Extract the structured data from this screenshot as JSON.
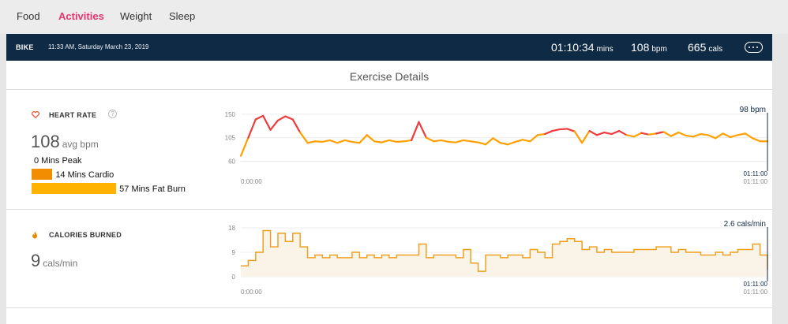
{
  "nav": {
    "tabs": [
      {
        "label": "Food",
        "active": false
      },
      {
        "label": "Activities",
        "active": true
      },
      {
        "label": "Weight",
        "active": false
      },
      {
        "label": "Sleep",
        "active": false
      }
    ]
  },
  "header": {
    "activity_type": "BIKE",
    "timestamp": "11:33 AM, Saturday March 23, 2019",
    "duration": "01:10:34",
    "duration_unit": "mins",
    "heart_rate": "108",
    "heart_rate_unit": "bpm",
    "calories": "665",
    "calories_unit": "cals",
    "menu_icon": "more-dots-icon"
  },
  "section_title": "Exercise Details",
  "heart_rate": {
    "label": "HEART RATE",
    "help_label": "?",
    "avg_value": "108",
    "avg_unit": "avg bpm",
    "zones": [
      {
        "label": "0 Mins Peak",
        "minutes": 0
      },
      {
        "label": "14 Mins Cardio",
        "minutes": 14,
        "color": "#f28c00"
      },
      {
        "label": "57 Mins Fat Burn",
        "minutes": 57,
        "color": "#ffb300"
      }
    ],
    "icon": "heart-icon",
    "accent": "#e8553a"
  },
  "calories": {
    "label": "CALORIES BURNED",
    "value": "9",
    "unit": "cals/min",
    "icon": "flame-icon",
    "accent": "#e88a00"
  },
  "chart_data": [
    {
      "type": "line",
      "title": "",
      "ylim": [
        50,
        165
      ],
      "yticks": [
        "150",
        "105",
        "60"
      ],
      "ytick_values": [
        150,
        105,
        60
      ],
      "x_start_label": "0:00:00",
      "x_end_label": "01:11:00",
      "cursor_readout": "98 bpm",
      "cursor_time": "01:11:00",
      "colors": {
        "low": "#8cc43c",
        "mid": "#ffa000",
        "high": "#ee3b3b"
      },
      "x": [
        0,
        1,
        2,
        3,
        4,
        5,
        6,
        7,
        8,
        9,
        10,
        11,
        12,
        13,
        14,
        15,
        16,
        17,
        18,
        19,
        20,
        21,
        22,
        23,
        24,
        25,
        26,
        27,
        28,
        29,
        30,
        31,
        32,
        33,
        34,
        35,
        36,
        37,
        38,
        39,
        40,
        41,
        42,
        43,
        44,
        45,
        46,
        47,
        48,
        49,
        50,
        51,
        52,
        53,
        54,
        55,
        56,
        57,
        58,
        59,
        60,
        61,
        62,
        63,
        64,
        65,
        66,
        67,
        68,
        69,
        70,
        71
      ],
      "values": [
        70,
        105,
        140,
        147,
        120,
        138,
        146,
        140,
        115,
        95,
        98,
        97,
        100,
        95,
        100,
        97,
        95,
        110,
        98,
        96,
        100,
        97,
        98,
        100,
        135,
        105,
        98,
        100,
        97,
        96,
        100,
        98,
        96,
        92,
        104,
        95,
        92,
        97,
        101,
        98,
        110,
        112,
        118,
        121,
        122,
        117,
        95,
        118,
        110,
        115,
        112,
        118,
        110,
        107,
        114,
        111,
        113,
        116,
        108,
        115,
        109,
        107,
        112,
        110,
        104,
        113,
        106,
        110,
        113,
        104,
        98,
        98
      ]
    },
    {
      "type": "area",
      "title": "",
      "ylim": [
        0,
        18
      ],
      "yticks": [
        "18",
        "9",
        "0"
      ],
      "ytick_values": [
        18,
        9,
        0
      ],
      "x_start_label": "0:00:00",
      "x_end_label": "01:11:00",
      "cursor_readout": "2.6 cals/min",
      "cursor_time": "01:11:00",
      "colors": {
        "line": "#f0a020",
        "fill": "#faf3e7"
      },
      "x": [
        0,
        1,
        2,
        3,
        4,
        5,
        6,
        7,
        8,
        9,
        10,
        11,
        12,
        13,
        14,
        15,
        16,
        17,
        18,
        19,
        20,
        21,
        22,
        23,
        24,
        25,
        26,
        27,
        28,
        29,
        30,
        31,
        32,
        33,
        34,
        35,
        36,
        37,
        38,
        39,
        40,
        41,
        42,
        43,
        44,
        45,
        46,
        47,
        48,
        49,
        50,
        51,
        52,
        53,
        54,
        55,
        56,
        57,
        58,
        59,
        60,
        61,
        62,
        63,
        64,
        65,
        66,
        67,
        68,
        69,
        70,
        71
      ],
      "values": [
        4,
        6,
        9,
        17,
        11,
        16,
        13,
        16,
        11,
        7,
        8,
        7,
        8,
        7,
        7,
        9,
        7,
        8,
        7,
        8,
        7,
        8,
        8,
        8,
        12,
        7,
        8,
        8,
        8,
        7,
        10,
        5,
        2,
        8,
        8,
        7,
        8,
        8,
        7,
        10,
        9,
        7,
        12,
        13,
        14,
        13,
        10,
        11,
        9,
        10,
        9,
        9,
        9,
        10,
        10,
        10,
        11,
        11,
        9,
        10,
        9,
        9,
        8,
        8,
        9,
        8,
        9,
        10,
        10,
        12,
        8,
        2.6
      ]
    }
  ]
}
